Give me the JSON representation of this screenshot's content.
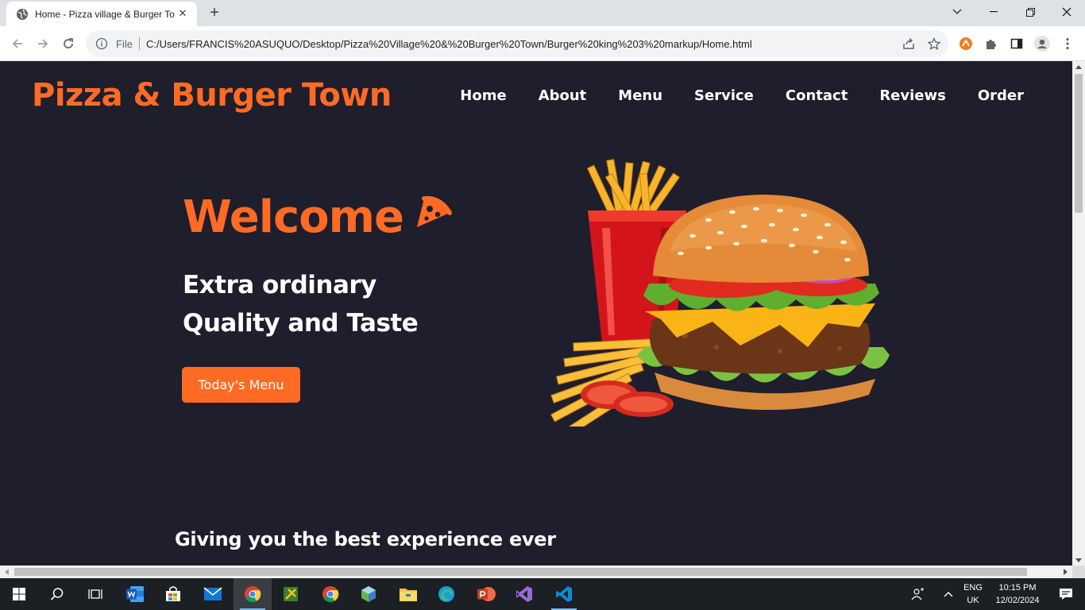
{
  "browser": {
    "tab_title": "Home - Pizza village & Burger To",
    "file_label": "File",
    "url": "C:/Users/FRANCIS%20ASUQUO/Desktop/Pizza%20Village%20&%20Burger%20Town/Burger%20king%203%20markup/Home.html"
  },
  "site": {
    "logo": "Pizza & Burger Town",
    "nav": [
      "Home",
      "About",
      "Menu",
      "Service",
      "Contact",
      "Reviews",
      "Order"
    ],
    "hero": {
      "welcome": "Welcome",
      "tagline_line1": "Extra ordinary",
      "tagline_line2": "Quality and Taste",
      "button": "Today's Menu"
    },
    "subheading": "Giving you the best experience ever"
  },
  "colors": {
    "accent": "#ff6b25",
    "page_bg": "#1f1e2c"
  },
  "taskbar": {
    "apps": [
      "start-icon",
      "search-icon",
      "task-view-icon",
      "word-icon",
      "store-icon",
      "mail-icon",
      "chrome-icon",
      "tool-icon",
      "chrome-icon",
      "box-icon",
      "file-explorer-icon",
      "edge-icon",
      "powerpoint-icon",
      "visual-studio-icon",
      "vscode-icon"
    ],
    "lang_line1": "ENG",
    "lang_line2": "UK",
    "time": "10:15 PM",
    "date": "12/02/2024"
  }
}
